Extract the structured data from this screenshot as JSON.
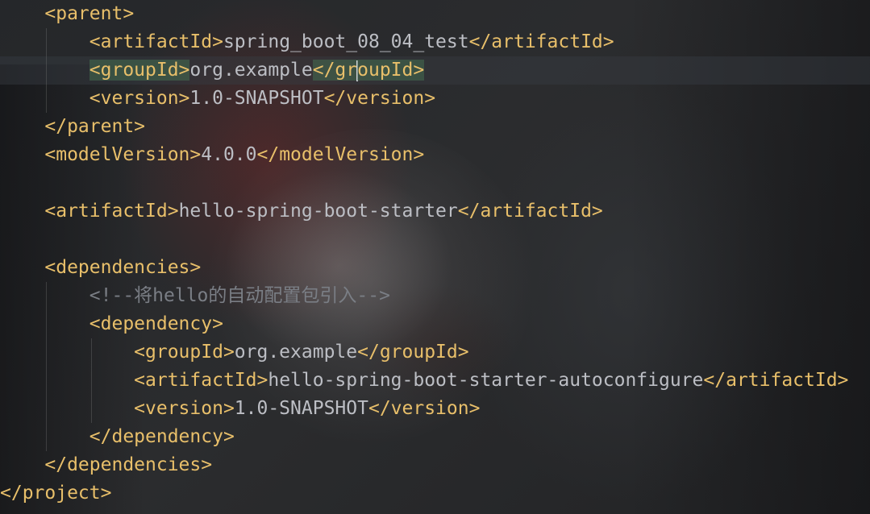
{
  "editor": {
    "lines": [
      {
        "indent": "    ",
        "segments": [
          {
            "kind": "tag",
            "text": "<parent>"
          }
        ]
      },
      {
        "indent": "        ",
        "segments": [
          {
            "kind": "tag",
            "text": "<artifactId>"
          },
          {
            "kind": "text",
            "text": "spring_boot_08_04_test"
          },
          {
            "kind": "tag",
            "text": "</artifactId>"
          }
        ]
      },
      {
        "indent": "        ",
        "segments": [
          {
            "kind": "tag",
            "text": "<groupId>"
          },
          {
            "kind": "text",
            "text": "org.example"
          },
          {
            "kind": "tag",
            "text": "</gr"
          },
          {
            "kind": "tag",
            "text": "oupId>"
          }
        ],
        "current": true
      },
      {
        "indent": "        ",
        "segments": [
          {
            "kind": "tag",
            "text": "<version>"
          },
          {
            "kind": "text",
            "text": "1.0-SNAPSHOT"
          },
          {
            "kind": "tag",
            "text": "</version>"
          }
        ]
      },
      {
        "indent": "    ",
        "segments": [
          {
            "kind": "tag",
            "text": "</parent>"
          }
        ]
      },
      {
        "indent": "    ",
        "segments": [
          {
            "kind": "tag",
            "text": "<modelVersion>"
          },
          {
            "kind": "text",
            "text": "4.0.0"
          },
          {
            "kind": "tag",
            "text": "</modelVersion>"
          }
        ]
      },
      {
        "indent": "",
        "segments": []
      },
      {
        "indent": "    ",
        "segments": [
          {
            "kind": "tag",
            "text": "<artifactId>"
          },
          {
            "kind": "text",
            "text": "hello-spring-boot-starter"
          },
          {
            "kind": "tag",
            "text": "</artifactId>"
          }
        ]
      },
      {
        "indent": "",
        "segments": []
      },
      {
        "indent": "    ",
        "segments": [
          {
            "kind": "tag",
            "text": "<dependencies>"
          }
        ]
      },
      {
        "indent": "        ",
        "segments": [
          {
            "kind": "comment",
            "text": "<!--将hello的自动配置包引入-->"
          }
        ]
      },
      {
        "indent": "        ",
        "segments": [
          {
            "kind": "tag",
            "text": "<dependency>"
          }
        ]
      },
      {
        "indent": "            ",
        "segments": [
          {
            "kind": "tag",
            "text": "<groupId>"
          },
          {
            "kind": "text",
            "text": "org.example"
          },
          {
            "kind": "tag",
            "text": "</groupId>"
          }
        ]
      },
      {
        "indent": "            ",
        "segments": [
          {
            "kind": "tag",
            "text": "<artifactId>"
          },
          {
            "kind": "text",
            "text": "hello-spring-boot-starter-autoconfigure"
          },
          {
            "kind": "tag",
            "text": "</artifactId>"
          }
        ]
      },
      {
        "indent": "            ",
        "segments": [
          {
            "kind": "tag",
            "text": "<version>"
          },
          {
            "kind": "text",
            "text": "1.0-SNAPSHOT"
          },
          {
            "kind": "tag",
            "text": "</version>"
          }
        ]
      },
      {
        "indent": "        ",
        "segments": [
          {
            "kind": "tag",
            "text": "</dependency>"
          }
        ]
      },
      {
        "indent": "    ",
        "segments": [
          {
            "kind": "tag",
            "text": "</dependencies>"
          }
        ]
      },
      {
        "indent": "",
        "segments": [
          {
            "kind": "tag",
            "text": "</project>"
          }
        ]
      }
    ]
  },
  "colors": {
    "tag": "#e8bf6a",
    "text": "#bcbec4",
    "comment": "#7a7e85",
    "tag_match_highlight": "#466e50"
  }
}
